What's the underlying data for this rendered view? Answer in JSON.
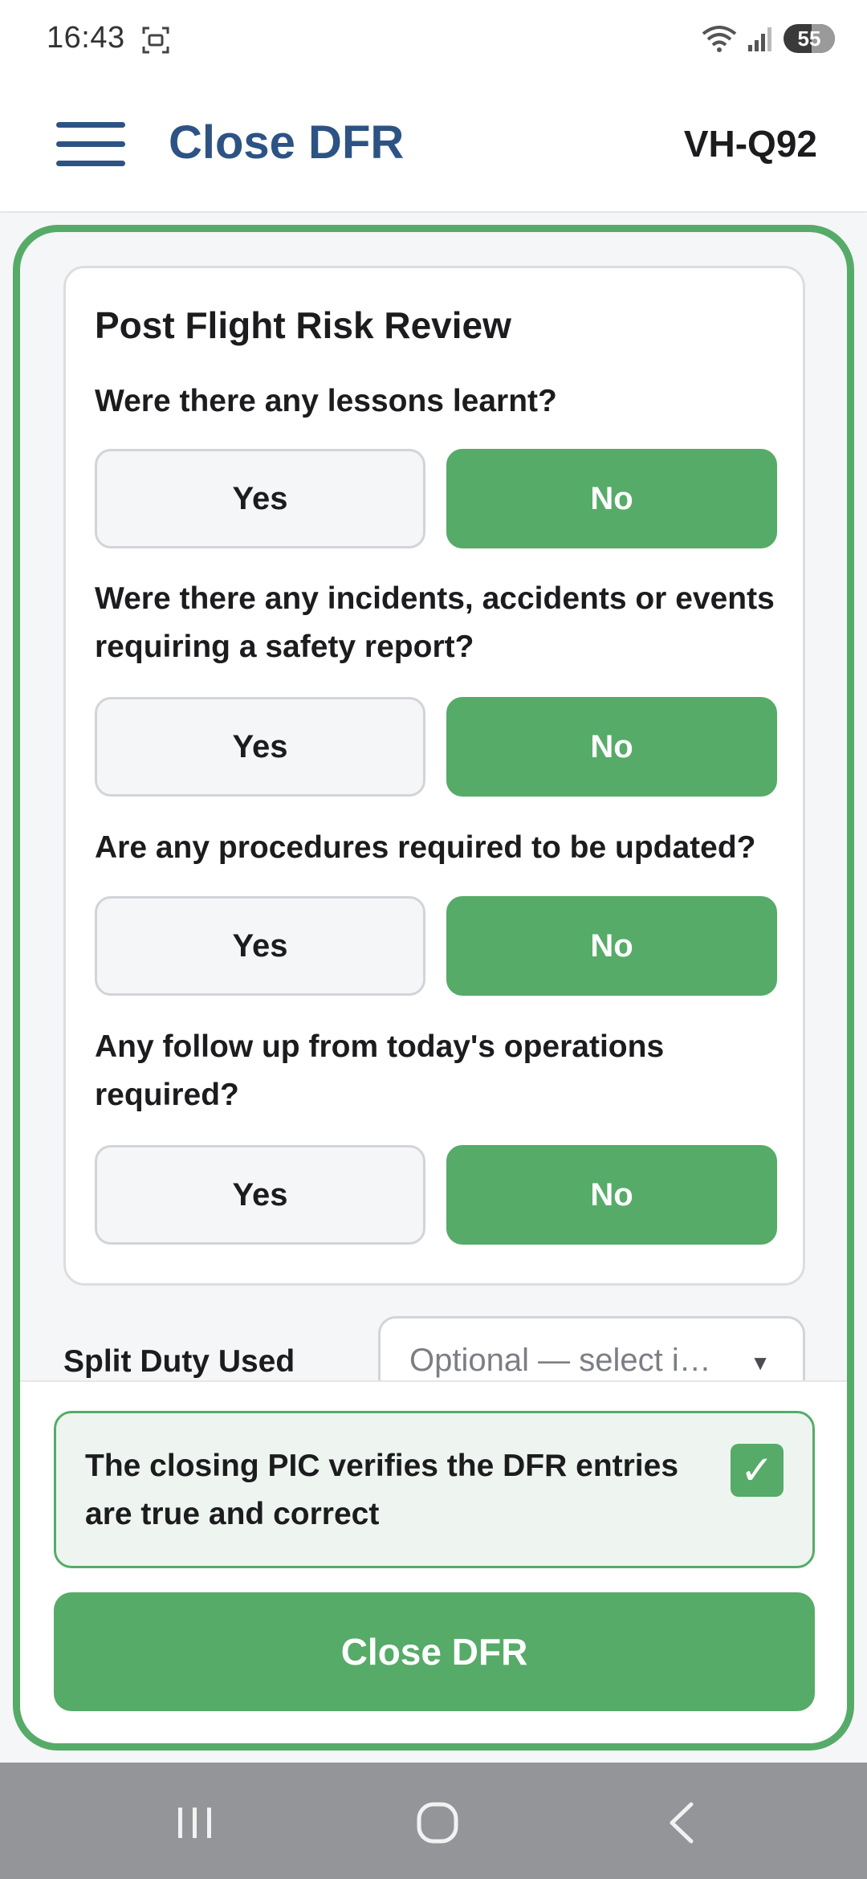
{
  "status_bar": {
    "time": "16:43",
    "battery": "55",
    "battery_level_percent": 55
  },
  "header": {
    "title": "Close DFR",
    "aircraft_registration": "VH-Q92"
  },
  "risk_review": {
    "title": "Post Flight Risk Review",
    "yes_label": "Yes",
    "no_label": "No",
    "questions": [
      {
        "text": "Were there any lessons learnt?",
        "selected": "No"
      },
      {
        "text": "Were there any incidents, accidents or events requiring a safety report?",
        "selected": "No"
      },
      {
        "text": "Are any procedures required to be updated?",
        "selected": "No"
      },
      {
        "text": "Any follow up from today's operations required?",
        "selected": "No"
      }
    ]
  },
  "split_duty": {
    "label": "Split Duty Used",
    "placeholder": "Optional — select i…"
  },
  "verification": {
    "text": "The closing PIC verifies the DFR entries are true and correct",
    "checked": true,
    "check_glyph": "✓"
  },
  "close_button": {
    "label": "Close DFR"
  },
  "icons": {
    "menu": "hamburger-menu-icon",
    "recents": "recent-apps-icon",
    "home": "home-icon",
    "back": "back-icon"
  },
  "colors": {
    "accent_green": "#56ab68",
    "title_blue": "#2d5384",
    "nav_bar": "#939598"
  }
}
